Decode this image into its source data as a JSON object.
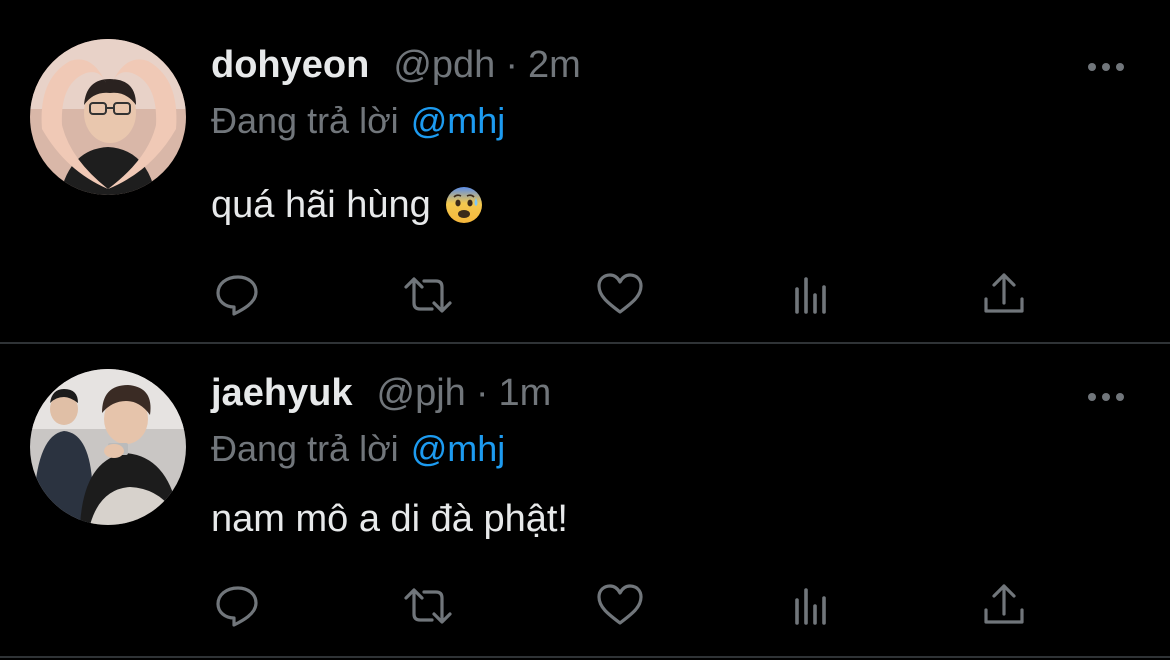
{
  "colors": {
    "background": "#000000",
    "text_primary": "#e7e9ea",
    "text_secondary": "#71767b",
    "accent": "#1d9bf0",
    "divider": "#2f3336"
  },
  "tweets": [
    {
      "display_name": "dohyeon",
      "handle": "@pdh",
      "separator": "·",
      "time": "2m",
      "reply_prefix": "Đang trả lời",
      "reply_to": "@mhj",
      "text": "quá hãi hùng",
      "emoji": "anxious-face-with-sweat",
      "avatar_icon": "profile-photo-heart-hands",
      "actions": [
        "reply-icon",
        "retweet-icon",
        "like-icon",
        "analytics-icon",
        "share-icon"
      ]
    },
    {
      "display_name": "jaehyuk",
      "handle": "@pjh",
      "separator": "·",
      "time": "1m",
      "reply_prefix": "Đang trả lời",
      "reply_to": "@mhj",
      "text": "nam mô a di đà phật!",
      "avatar_icon": "profile-photo-two-people",
      "actions": [
        "reply-icon",
        "retweet-icon",
        "like-icon",
        "analytics-icon",
        "share-icon"
      ]
    }
  ]
}
